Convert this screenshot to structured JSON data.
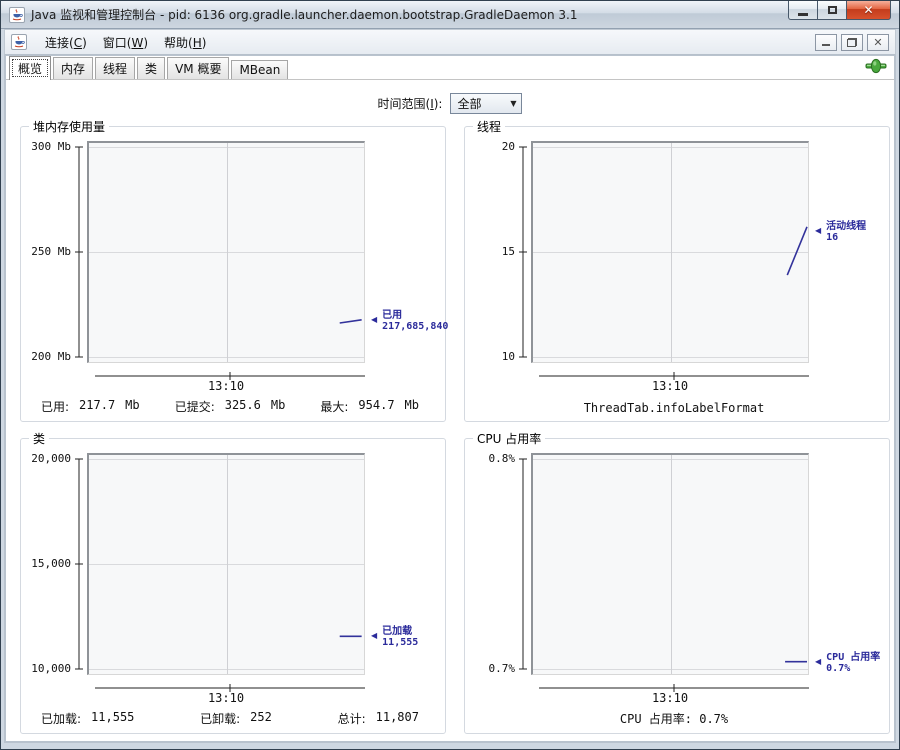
{
  "window": {
    "title": "Java 监视和管理控制台 - pid: 6136 org.gradle.launcher.daemon.bootstrap.GradleDaemon 3.1",
    "controls": [
      "minimize",
      "maximize",
      "close"
    ]
  },
  "menu": {
    "items": [
      "连接(C)",
      "窗口(W)",
      "帮助(H)"
    ]
  },
  "inner_window_controls": [
    "minimize",
    "restore",
    "close"
  ],
  "tabs": {
    "items": [
      "概览",
      "内存",
      "线程",
      "类",
      "VM 概要",
      "MBean"
    ],
    "selected": "概览"
  },
  "toolbar": {
    "time_range_label": "时间范围(I):",
    "time_range_value": "全部"
  },
  "colors": {
    "series": "#32329b",
    "annotation": "#2b2b9b",
    "grid": "#d9dadd",
    "status_green": "#4aab3e"
  },
  "chart_data": [
    {
      "type": "line",
      "title": "堆内存使用量",
      "ylabel": "",
      "xlabel": "",
      "ylim": [
        200,
        300
      ],
      "y_ticks": [
        {
          "label": "300 Mb",
          "frac": 0
        },
        {
          "label": "250 Mb",
          "frac": 0.5
        },
        {
          "label": "200 Mb",
          "frac": 1
        }
      ],
      "x_tick": "13:10",
      "series": [
        {
          "name": "已用",
          "points": [
            [
              0.915,
              216.2
            ],
            [
              0.995,
              217.7
            ]
          ]
        }
      ],
      "annotation": {
        "lines": [
          "已用",
          "217,685,840"
        ],
        "value": 217.7
      },
      "stats": [
        {
          "label": "已用:",
          "value": "217.7",
          "unit": "Mb"
        },
        {
          "label": "已提交:",
          "value": "325.6",
          "unit": "Mb"
        },
        {
          "label": "最大:",
          "value": "954.7",
          "unit": "Mb"
        }
      ]
    },
    {
      "type": "line",
      "title": "线程",
      "ylabel": "",
      "xlabel": "",
      "ylim": [
        10,
        20
      ],
      "y_ticks": [
        {
          "label": "20",
          "frac": 0
        },
        {
          "label": "15",
          "frac": 0.5
        },
        {
          "label": "10",
          "frac": 1
        }
      ],
      "x_tick": "13:10",
      "series": [
        {
          "name": "活动线程",
          "points": [
            [
              0.928,
              13.9
            ],
            [
              1.0,
              16.2
            ]
          ]
        }
      ],
      "annotation": {
        "lines": [
          "活动线程",
          "16"
        ],
        "value": 16
      },
      "stats_text": "ThreadTab.infoLabelFormat"
    },
    {
      "type": "line",
      "title": "类",
      "ylabel": "",
      "xlabel": "",
      "ylim": [
        10000,
        20000
      ],
      "y_ticks": [
        {
          "label": "20,000",
          "frac": 0
        },
        {
          "label": "15,000",
          "frac": 0.5
        },
        {
          "label": "10,000",
          "frac": 1
        }
      ],
      "x_tick": "13:10",
      "series": [
        {
          "name": "已加载",
          "points": [
            [
              0.915,
              11555
            ],
            [
              0.995,
              11555
            ]
          ]
        }
      ],
      "annotation": {
        "lines": [
          "已加载",
          "11,555"
        ],
        "value": 11555
      },
      "stats": [
        {
          "label": "已加载:",
          "value": "11,555",
          "unit": ""
        },
        {
          "label": "已卸载:",
          "value": "252",
          "unit": ""
        },
        {
          "label": "总计:",
          "value": "11,807",
          "unit": ""
        }
      ]
    },
    {
      "type": "line",
      "title": "CPU 占用率",
      "ylabel": "",
      "xlabel": "",
      "ylim": [
        0.7,
        0.8
      ],
      "y_ticks": [
        {
          "label": "0.8%",
          "frac": 0
        },
        {
          "label": "0.7%",
          "frac": 1
        }
      ],
      "x_tick": "13:10",
      "series": [
        {
          "name": "CPU 占用率",
          "points": [
            [
              0.92,
              0.7035
            ],
            [
              1.0,
              0.7035
            ]
          ]
        }
      ],
      "annotation": {
        "lines": [
          "CPU 占用率",
          "0.7%"
        ],
        "value": 0.7035
      },
      "stats_text": "CPU 占用率: 0.7%"
    }
  ]
}
